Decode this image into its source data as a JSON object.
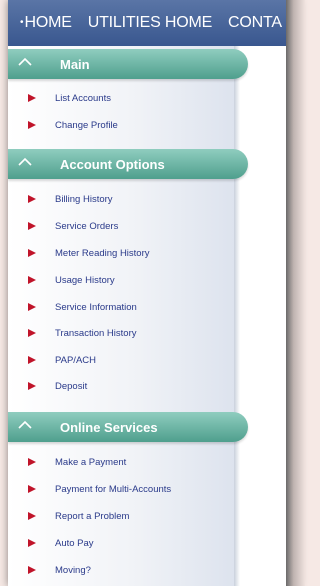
{
  "nav": {
    "bullet": "•",
    "items": [
      "HOME",
      "UTILITIES HOME",
      "CONTA"
    ]
  },
  "sections": [
    {
      "title": "Main",
      "items": [
        "List Accounts",
        "Change Profile"
      ]
    },
    {
      "title": "Account Options",
      "items": [
        "Billing History",
        "Service Orders",
        "Meter Reading History",
        "Usage History",
        "Service Information",
        "Transaction History",
        "PAP/ACH",
        "Deposit"
      ]
    },
    {
      "title": "Online Services",
      "items": [
        "Make a Payment",
        "Payment for Multi-Accounts",
        "Report a Problem",
        "Auto Pay",
        "Moving?"
      ]
    }
  ],
  "colors": {
    "nav_bg": "#3f5d93",
    "header_bg": "#5fae9b",
    "link": "#2a3a8a",
    "arrow": "#c0142a"
  },
  "icons": {
    "section_toggle": "chevron-up-icon",
    "menu_bullet": "red-triangle-arrow-icon"
  }
}
